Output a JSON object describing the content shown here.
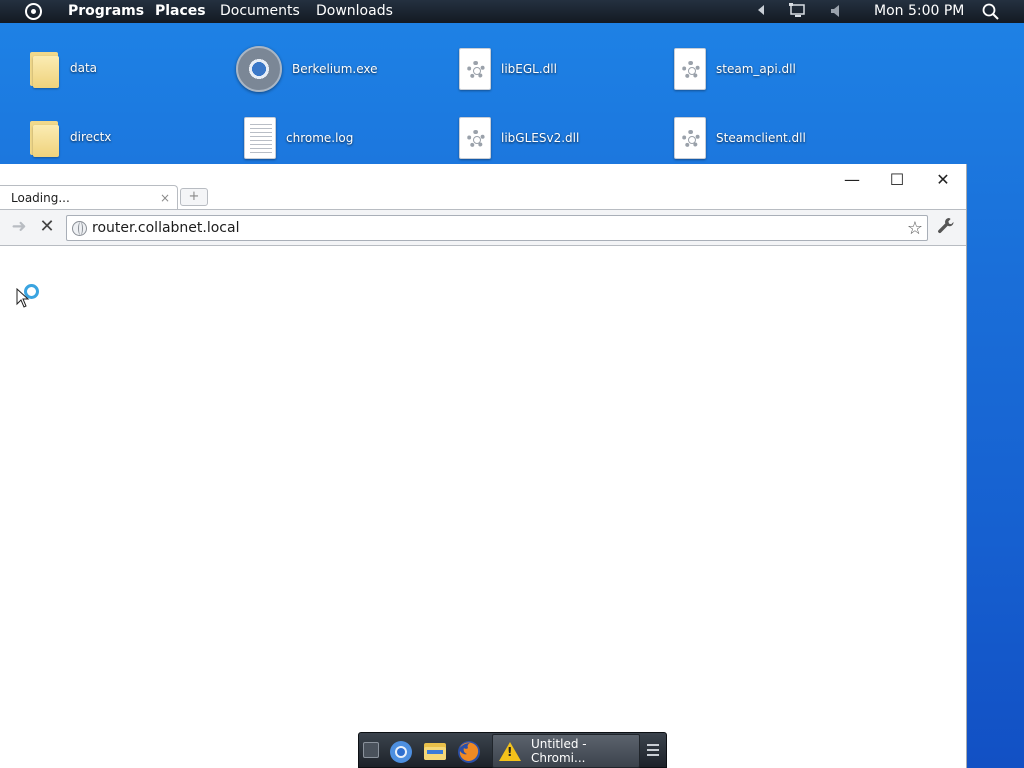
{
  "panel": {
    "menus": [
      "Programs",
      "Places",
      "Documents",
      "Downloads"
    ],
    "clock": "Mon 5:00 PM",
    "icons": [
      "menu-logo-icon",
      "arrow-left-icon",
      "network-icon",
      "volume-icon",
      "search-icon"
    ]
  },
  "desktop": {
    "icons": [
      {
        "label": "data",
        "type": "folder"
      },
      {
        "label": "Berkelium.exe",
        "type": "app"
      },
      {
        "label": "libEGL.dll",
        "type": "dll"
      },
      {
        "label": "steam_api.dll",
        "type": "dll"
      },
      {
        "label": "directx",
        "type": "folder"
      },
      {
        "label": "chrome.log",
        "type": "text"
      },
      {
        "label": "libGLESv2.dll",
        "type": "dll"
      },
      {
        "label": "Steamclient.dll",
        "type": "dll"
      }
    ]
  },
  "browser": {
    "tab_title": "Loading...",
    "tab_close": "×",
    "new_tab": "+",
    "url": "router.collabnet.local",
    "controls": {
      "minimize": "—",
      "maximize": "☐",
      "close": "✕"
    },
    "toolbar": {
      "forward": "➜",
      "stop": "✕",
      "star": "☆",
      "wrench": "🔧"
    }
  },
  "dock": {
    "active_window": "Untitled - Chromi...",
    "icons": [
      "show-desktop-icon",
      "chromium-icon",
      "file-manager-icon",
      "firefox-icon",
      "warning-icon",
      "dock-menu-icon"
    ]
  },
  "colors": {
    "desktop": "#1a6fd9",
    "panel": "#131a22",
    "spinner": "#3aa4e0"
  }
}
